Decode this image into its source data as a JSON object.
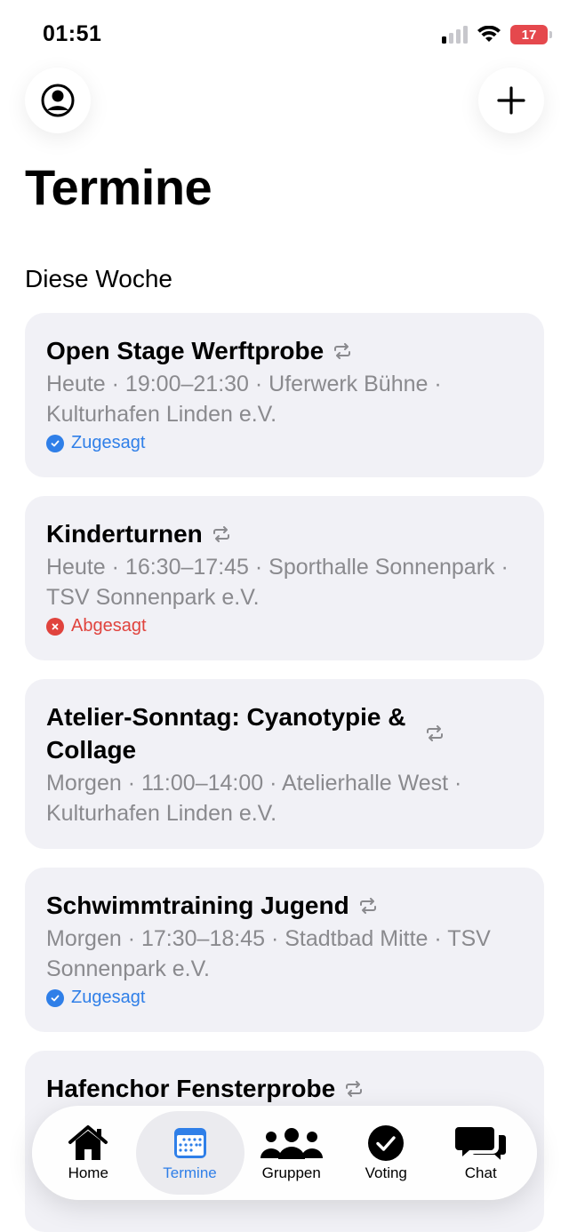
{
  "status_bar": {
    "time": "01:51",
    "battery": "17"
  },
  "header": {
    "title": "Termine"
  },
  "section": {
    "title": "Diese Woche"
  },
  "events": [
    {
      "title": "Open Stage Werftprobe",
      "meta": "Heute · 19:00–21:30 · Uferwerk Bühne · Kulturhafen Linden e.V.",
      "status": "Zugesagt"
    },
    {
      "title": "Kinderturnen",
      "meta": "Heute · 16:30–17:45 · Sporthalle Sonnenpark · TSV Sonnenpark e.V.",
      "status": "Abgesagt"
    },
    {
      "title": "Atelier-Sonntag: Cyanotypie & Collage",
      "meta": "Morgen · 11:00–14:00 · Atelierhalle West · Kulturhafen Linden e.V.",
      "status": ""
    },
    {
      "title": "Schwimmtraining Jugend",
      "meta": "Morgen · 17:30–18:45 · Stadtbad Mitte · TSV Sonnenpark e.V.",
      "status": "Zugesagt"
    },
    {
      "title": "Hafenchor Fensterprobe",
      "meta": "",
      "status": ""
    }
  ],
  "tabs": [
    {
      "label": "Home",
      "icon": "home-icon"
    },
    {
      "label": "Termine",
      "icon": "calendar-icon"
    },
    {
      "label": "Gruppen",
      "icon": "groups-icon"
    },
    {
      "label": "Voting",
      "icon": "check-circle-icon"
    },
    {
      "label": "Chat",
      "icon": "chat-icon"
    }
  ],
  "colors": {
    "accent": "#2f7fe8",
    "declined": "#e0433d",
    "card_bg": "#f1f1f6",
    "meta_text": "#8a8a8e"
  }
}
